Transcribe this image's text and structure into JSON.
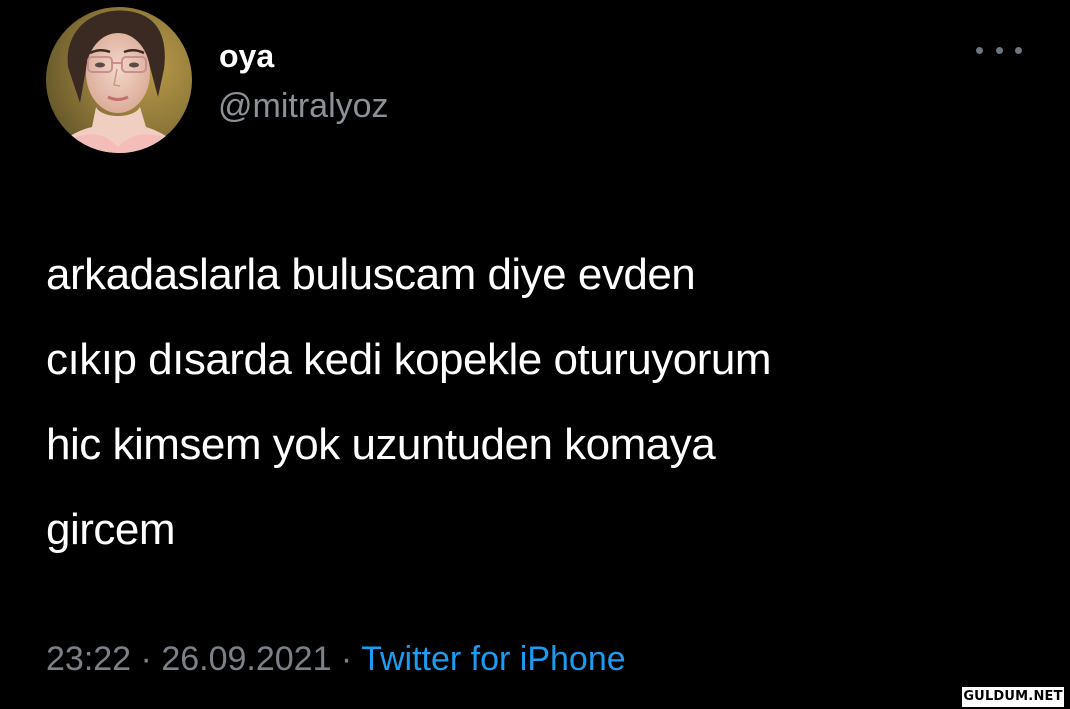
{
  "user": {
    "display_name": "oya",
    "handle": "@mitralyoz",
    "avatar_icon": "profile-photo"
  },
  "more_icon": "more-options-icon",
  "tweet": {
    "lines": [
      "arkadaslarla buluscam diye evden",
      "cıkıp dısarda kedi kopekle oturuyorum",
      "hic kimsem yok uzuntuden komaya",
      "gircem"
    ]
  },
  "meta": {
    "time": "23:22",
    "separator_1": " · ",
    "date": "26.09.2021",
    "separator_2": " · ",
    "source": "Twitter for iPhone"
  },
  "watermark": "GULDUM.NET",
  "colors": {
    "background": "#000000",
    "text": "#ffffff",
    "secondary": "#8b9198",
    "link": "#1d9bf0"
  }
}
